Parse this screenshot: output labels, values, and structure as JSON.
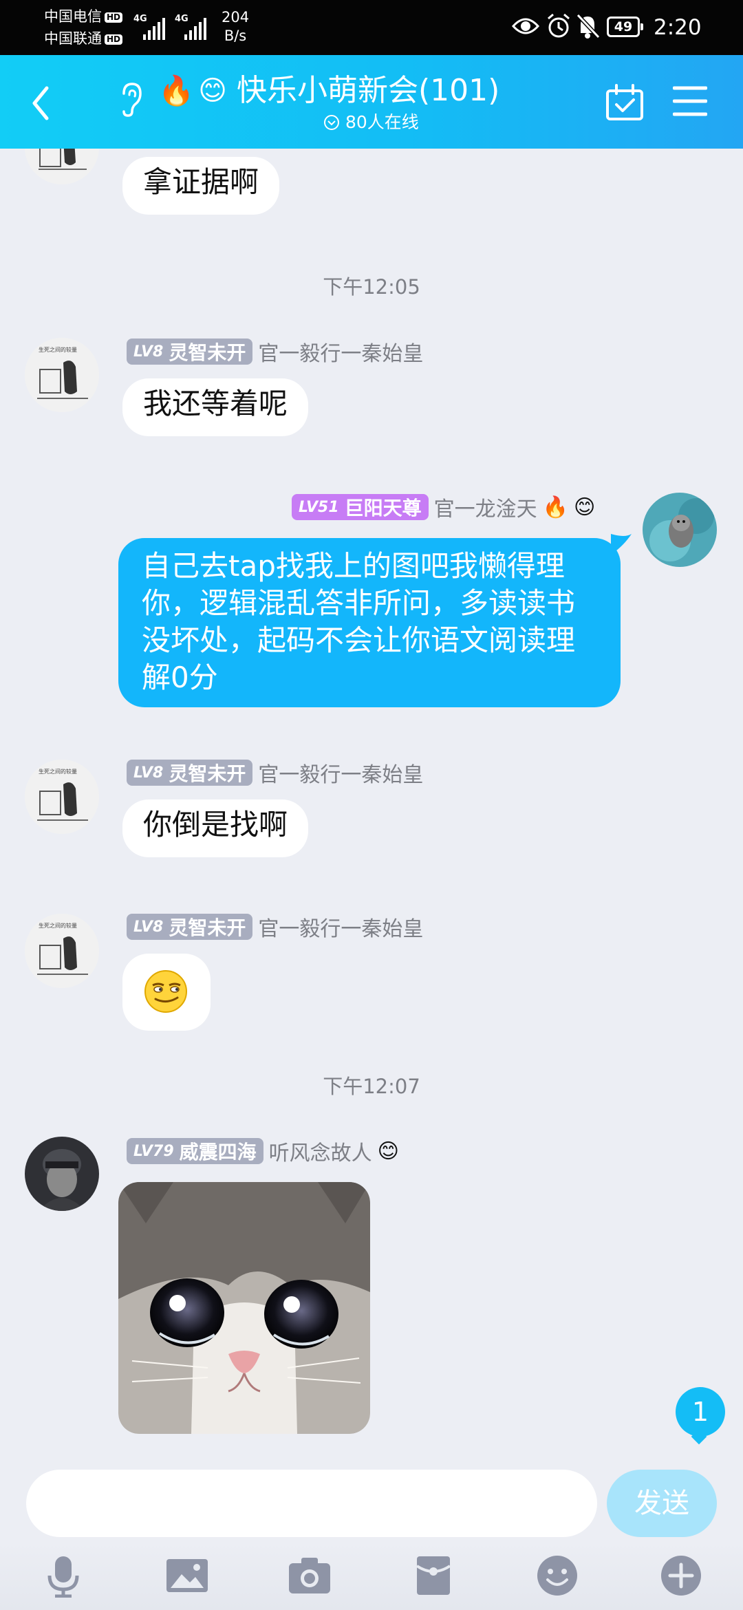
{
  "status_bar": {
    "carrier1": "中国电信",
    "carrier2": "中国联通",
    "hd": "HD",
    "network1": "4G",
    "network2": "4G",
    "net_speed_value": "204",
    "net_speed_unit": "B/s",
    "battery": "49",
    "time": "2:20"
  },
  "header": {
    "title": "快乐小萌新会(101)",
    "online": "80人在线"
  },
  "chat": {
    "messages": [
      {
        "text": "拿证据啊"
      },
      {
        "time": "下午12:05"
      },
      {
        "level": "LV8",
        "title": "灵智未开",
        "name": "官一毅行一秦始皇",
        "text": "我还等着呢"
      },
      {
        "level": "LV51",
        "title": "巨阳天尊",
        "name": "官一龙淦天",
        "text": "自己去tap找我上的图吧我懒得理你，逻辑混乱答非所问，多读读书没坏处，起码不会让你语文阅读理解0分"
      },
      {
        "level": "LV8",
        "title": "灵智未开",
        "name": "官一毅行一秦始皇",
        "text": "你倒是找啊"
      },
      {
        "level": "LV8",
        "title": "灵智未开",
        "name": "官一毅行一秦始皇",
        "emoji": "smirk-face-icon"
      },
      {
        "time": "下午12:07"
      },
      {
        "level": "LV79",
        "title": "威震四海",
        "name": "听风念故人",
        "image": "crying-cat-sticker"
      }
    ],
    "unread_count": "1"
  },
  "input_bar": {
    "placeholder": "",
    "send_label": "发送"
  },
  "colors": {
    "header_start": "#12cdf6",
    "header_end": "#23a6f3",
    "bubble_out": "#13b6fb",
    "background": "#eceef4",
    "lv_gray": "#a8adbf",
    "lv_purple": "#c77cf5"
  },
  "icons": [
    "back-icon",
    "ear-icon",
    "fire-icon",
    "smile-icon",
    "calendar-check-icon",
    "menu-icon",
    "mic-icon",
    "image-icon",
    "camera-icon",
    "red-envelope-icon",
    "emoji-icon",
    "plus-icon"
  ]
}
